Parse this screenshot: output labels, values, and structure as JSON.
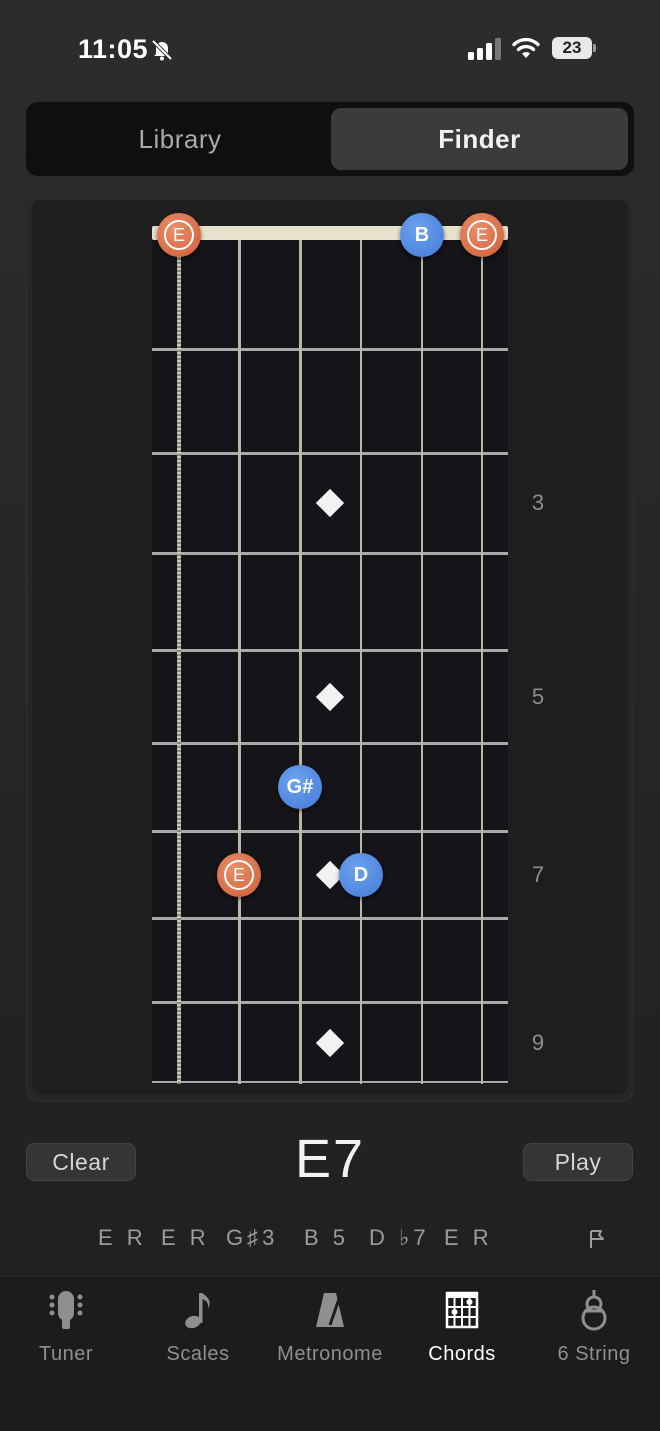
{
  "status_bar": {
    "time": "11:05",
    "battery": "23"
  },
  "segmented": {
    "library": "Library",
    "finder": "Finder",
    "selected": "Finder"
  },
  "fretboard": {
    "fret_markers": [
      "3",
      "5",
      "7",
      "9"
    ],
    "notes": [
      {
        "label": "E",
        "string": 1,
        "fret": 0,
        "root": true
      },
      {
        "label": "B",
        "string": 5,
        "fret": 0,
        "root": false
      },
      {
        "label": "E",
        "string": 6,
        "fret": 0,
        "root": true
      },
      {
        "label": "G#",
        "string": 3,
        "fret": 6,
        "root": false
      },
      {
        "label": "E",
        "string": 2,
        "fret": 7,
        "root": true
      },
      {
        "label": "D",
        "string": 4,
        "fret": 7,
        "root": false
      }
    ]
  },
  "controls": {
    "clear": "Clear",
    "chord": "E7",
    "play": "Play"
  },
  "intervals": [
    "E R",
    "E R",
    "G♯3",
    "B 5",
    "D ♭7",
    "E R"
  ],
  "tabs": [
    {
      "label": "Tuner",
      "icon": "tuner-icon"
    },
    {
      "label": "Scales",
      "icon": "music-note-icon"
    },
    {
      "label": "Metronome",
      "icon": "metronome-icon"
    },
    {
      "label": "Chords",
      "icon": "chord-grid-icon",
      "active": true
    },
    {
      "label": "6 String",
      "icon": "guitar-icon"
    }
  ],
  "colors": {
    "root_note": "#d66c46",
    "other_note": "#4f86de",
    "fretboard": "#141419"
  }
}
